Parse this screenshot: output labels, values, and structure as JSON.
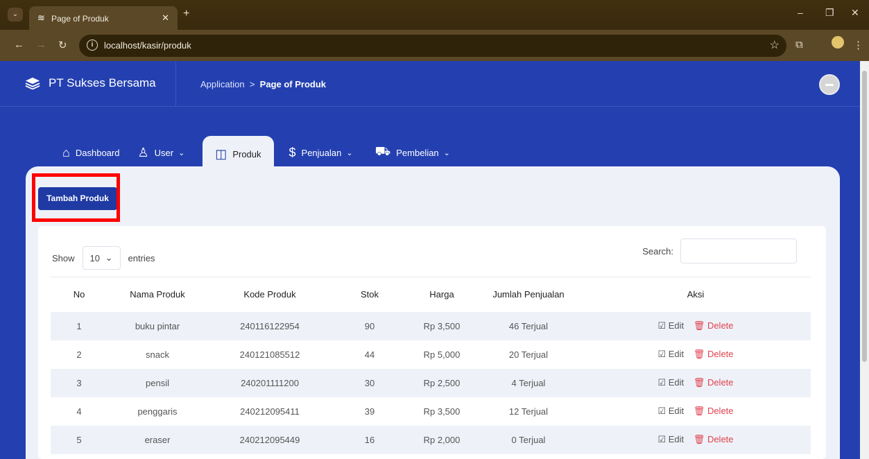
{
  "browser": {
    "tab_title": "Page of Produk",
    "url": "localhost/kasir/produk"
  },
  "header": {
    "brand": "PT Sukses Bersama",
    "breadcrumb_parent": "Application",
    "breadcrumb_sep": ">",
    "breadcrumb_current": "Page of Produk"
  },
  "menu": {
    "dashboard": "Dashboard",
    "user": "User",
    "produk": "Produk",
    "penjualan": "Penjualan",
    "pembelian": "Pembelian"
  },
  "actions": {
    "add_label": "Tambah Produk"
  },
  "table_controls": {
    "show_label": "Show",
    "entries_value": "10",
    "entries_label": "entries",
    "search_label": "Search:"
  },
  "table": {
    "headers": [
      "No",
      "Nama Produk",
      "Kode Produk",
      "Stok",
      "Harga",
      "Jumlah Penjualan",
      "Aksi"
    ],
    "edit_label": "Edit",
    "delete_label": "Delete",
    "rows": [
      {
        "no": "1",
        "nama": "buku pintar",
        "kode": "240116122954",
        "stok": "90",
        "harga": "Rp 3,500",
        "jual": "46 Terjual"
      },
      {
        "no": "2",
        "nama": "snack",
        "kode": "240121085512",
        "stok": "44",
        "harga": "Rp 5,000",
        "jual": "20 Terjual"
      },
      {
        "no": "3",
        "nama": "pensil",
        "kode": "240201111200",
        "stok": "30",
        "harga": "Rp 2,500",
        "jual": "4 Terjual"
      },
      {
        "no": "4",
        "nama": "penggaris",
        "kode": "240212095411",
        "stok": "39",
        "harga": "Rp 3,500",
        "jual": "12 Terjual"
      },
      {
        "no": "5",
        "nama": "eraser",
        "kode": "240212095449",
        "stok": "16",
        "harga": "Rp 2,000",
        "jual": "0 Terjual"
      }
    ]
  }
}
